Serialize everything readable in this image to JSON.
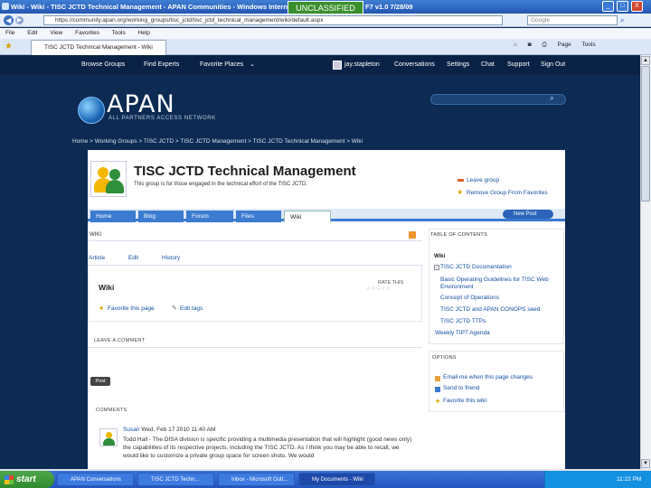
{
  "browser": {
    "title": "Wiki - Wiki - TISC JCTD Technical Management - APAN Communities - Windows Internet",
    "classification_banner": "UNCLASSIFIED",
    "version_tag": "F7 v1.0 7/28/09",
    "url": "https://community.apan.org/working_groups/tisc_jctd/tisc_jctd_technical_management/wiki/default.aspx",
    "search_placeholder": "Google",
    "menu": [
      "File",
      "Edit",
      "View",
      "Favorites",
      "Tools",
      "Help"
    ],
    "tab_label": "TISC JCTD Technical Management - Wiki",
    "command_bar": [
      "Page",
      "Tools"
    ],
    "window_buttons": [
      "_",
      "□",
      "X"
    ]
  },
  "site": {
    "nav": [
      "Browse Groups",
      "Find Experts",
      "Favorite Places",
      "jay.stapleton",
      "Conversations",
      "Settings",
      "Chat",
      "Support",
      "Sign Out"
    ],
    "logo_text": "APAN",
    "logo_tagline": "ALL PARTNERS ACCESS NETWORK",
    "breadcrumb": "Home  >  Working Groups  >  TISC JCTD  >  TISC JCTD Management  >  TISC JCTD Technical Management  >  Wiki"
  },
  "group": {
    "title": "TISC JCTD Technical Management",
    "description": "This group is for those engaged in the technical effort of the TISC JCTD.",
    "actions": [
      "Leave group",
      "Remove Group From Favorites"
    ],
    "tabs": [
      "Home",
      "Blog",
      "Forum",
      "Files",
      "Wiki"
    ],
    "new_post": "New Post"
  },
  "wiki": {
    "section_label": "WIKI",
    "subtabs": [
      "Article",
      "Edit",
      "History"
    ],
    "heading": "Wiki",
    "rate_label": "RATE THIS",
    "rate_stars": "☆☆☆☆☆",
    "favorite_link": "Favorite this page",
    "edit_tags_link": "Edit tags",
    "leave_comment": "LEAVE A COMMENT",
    "post_button": "Post",
    "comments_label": "COMMENTS"
  },
  "comment": {
    "author": "Susan",
    "timestamp": "Wed, Feb 17 2010 11:40 AM",
    "text": "Todd Hall - The DISA division is specific providing a multimedia presentation that will highlight (good news only) the capabilities of its respective projects, including the TISC JCTD. As I think you may be able to recall, we would like to customize a private group space for screen shots. We would"
  },
  "toc": {
    "header": "TABLE OF CONTENTS",
    "root": "Wiki",
    "items": [
      "TISC JCTD Documentation",
      "Basic Operating Guidelines for TISC Web Environment",
      "Concept of Operations",
      "TISC JCTD and APAN CONOPS seed",
      "TISC JCTD TTPs",
      "Weekly TIPT Agenda"
    ]
  },
  "options": {
    "header": "OPTIONS",
    "items": [
      "Email me when this page changes",
      "Send to friend",
      "Favorite this wiki"
    ]
  },
  "taskbar": {
    "start": "start",
    "tasks": [
      "APAN Conversations",
      "TISC JCTD Techn...",
      "Inbox - Microsoft Outl...",
      "My Documents - Wiki"
    ],
    "clock": "11:22 PM"
  },
  "colors": {
    "site_bg": "#0c2a52",
    "accent": "#3b7bd0",
    "classification": "#3a8f2d",
    "link": "#134f9e"
  }
}
